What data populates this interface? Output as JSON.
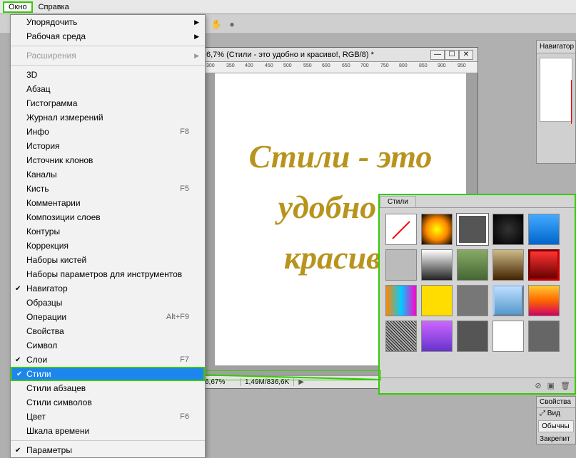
{
  "menubar": {
    "okno": "Окно",
    "spravka": "Справка"
  },
  "dropdown": {
    "uporyadochit": "Упорядочить",
    "rabochaya_sreda": "Рабочая среда",
    "rasshireniya": "Расширения",
    "3d": "3D",
    "abzac": "Абзац",
    "gistogramma": "Гистограмма",
    "zhurnal": "Журнал измерений",
    "info": "Инфо",
    "info_key": "F8",
    "istoriya": "История",
    "istochnik": "Источник клонов",
    "kanaly": "Каналы",
    "kist": "Кисть",
    "kist_key": "F5",
    "kommentarii": "Комментарии",
    "kompoz": "Композиции слоев",
    "kontury": "Контуры",
    "korrekciya": "Коррекция",
    "nabory_kistej": "Наборы кистей",
    "nabory_param": "Наборы параметров для инструментов",
    "navigator": "Навигатор",
    "obrazcy": "Образцы",
    "operacii": "Операции",
    "operacii_key": "Alt+F9",
    "svojstva": "Свойства",
    "simvol": "Символ",
    "sloi": "Слои",
    "sloi_key": "F7",
    "stili": "Стили",
    "stili_abzacev": "Стили абзацев",
    "stili_simvolov": "Стили символов",
    "cvet": "Цвет",
    "cvet_key": "F6",
    "shkala": "Шкала времени",
    "parametry": "Параметры"
  },
  "doc": {
    "title": "6,7% (Стили - это удобно и красиво!, RGB/8) *",
    "line1": "Стили - это",
    "line2": "удобно и",
    "line3": "красиво",
    "zoom": "6,67%",
    "size": "1,49M/836,6K"
  },
  "ruler": {
    "t300": "300",
    "t350": "350",
    "t400": "400",
    "t450": "450",
    "t500": "500",
    "t550": "550",
    "t600": "600",
    "t650": "650",
    "t700": "700",
    "t750": "750",
    "t800": "800",
    "t850": "850",
    "t900": "900",
    "t950": "950"
  },
  "nav": {
    "title": "Навигатор"
  },
  "styles": {
    "tab": "Стили"
  },
  "props": {
    "title": "Свойства",
    "vid": "Вид",
    "obychn": "Обычны",
    "zakrep": "Закрепит"
  },
  "icons": {
    "no_style": "∅",
    "new": "⬜",
    "trash": "🗑"
  }
}
